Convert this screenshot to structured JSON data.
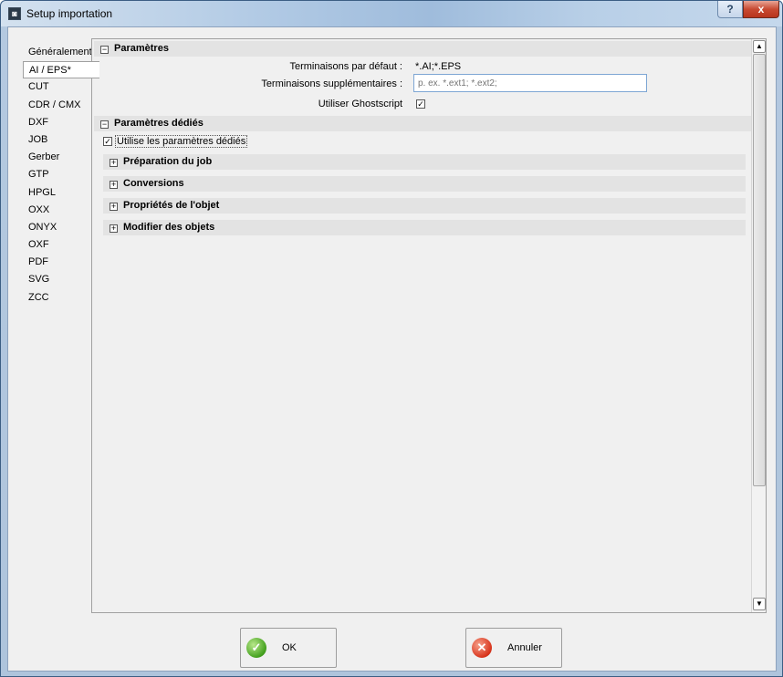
{
  "window": {
    "title": "Setup importation",
    "help_label": "?",
    "close_label": "x"
  },
  "nav": {
    "items": [
      {
        "label": "Généralement",
        "selected": false
      },
      {
        "label": "AI / EPS*",
        "selected": true
      },
      {
        "label": "CUT",
        "selected": false
      },
      {
        "label": "CDR / CMX",
        "selected": false
      },
      {
        "label": "DXF",
        "selected": false
      },
      {
        "label": "JOB",
        "selected": false
      },
      {
        "label": "Gerber",
        "selected": false
      },
      {
        "label": "GTP",
        "selected": false
      },
      {
        "label": "HPGL",
        "selected": false
      },
      {
        "label": "OXX",
        "selected": false
      },
      {
        "label": "ONYX",
        "selected": false
      },
      {
        "label": "OXF",
        "selected": false
      },
      {
        "label": "PDF",
        "selected": false
      },
      {
        "label": "SVG",
        "selected": false
      },
      {
        "label": "ZCC",
        "selected": false
      }
    ]
  },
  "parametres": {
    "header": "Paramètres",
    "default_ext_label": "Terminaisons par défaut :",
    "default_ext_value": "*.AI;*.EPS",
    "extra_ext_label": "Terminaisons supplémentaires :",
    "extra_ext_value": "",
    "extra_ext_placeholder": "p. ex. *.ext1; *.ext2;",
    "ghostscript_label": "Utiliser Ghostscript",
    "ghostscript_checked": true
  },
  "dedies": {
    "header": "Paramètres dédiés",
    "use_dedicated_label": "Utilise les paramètres dédiés",
    "use_dedicated_checked": true,
    "subsections": [
      {
        "label": "Préparation du job",
        "expanded": false
      },
      {
        "label": "Conversions",
        "expanded": false
      },
      {
        "label": "Propriétés de l'objet",
        "expanded": false
      },
      {
        "label": "Modifier des objets",
        "expanded": false
      }
    ]
  },
  "buttons": {
    "ok_label": "OK",
    "cancel_label": "Annuler"
  },
  "glyphs": {
    "collapse": "−",
    "expand": "+",
    "check": "✓",
    "arrow_up": "▲",
    "arrow_down": "▼"
  }
}
